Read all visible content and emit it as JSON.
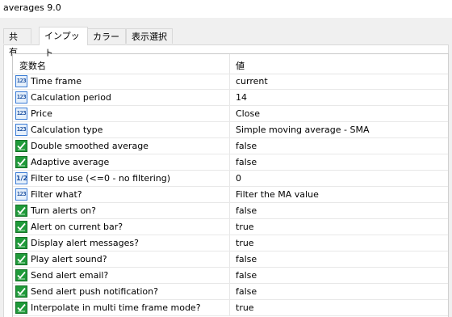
{
  "window": {
    "title": "averages 9.0"
  },
  "tabs": [
    {
      "label": "共有",
      "active": false
    },
    {
      "label": "インプット",
      "active": true
    },
    {
      "label": "カラー",
      "active": false
    },
    {
      "label": "表示選択",
      "active": false
    }
  ],
  "grid": {
    "headers": {
      "name": "変数名",
      "value": "値"
    },
    "rows": [
      {
        "icon": "int",
        "icon_text": "123",
        "name": "Time frame",
        "value": "current"
      },
      {
        "icon": "int",
        "icon_text": "123",
        "name": "Calculation period",
        "value": "14"
      },
      {
        "icon": "int",
        "icon_text": "123",
        "name": "Price",
        "value": "Close"
      },
      {
        "icon": "int",
        "icon_text": "123",
        "name": "Calculation type",
        "value": "Simple moving average - SMA"
      },
      {
        "icon": "bool",
        "icon_text": "",
        "name": "Double smoothed average",
        "value": "false"
      },
      {
        "icon": "bool",
        "icon_text": "",
        "name": "Adaptive average",
        "value": "false"
      },
      {
        "icon": "double",
        "icon_text": "1/2",
        "name": "Filter to use (<=0 - no filtering)",
        "value": "0"
      },
      {
        "icon": "int",
        "icon_text": "123",
        "name": "Filter what?",
        "value": "Filter the MA value"
      },
      {
        "icon": "bool",
        "icon_text": "",
        "name": "Turn alerts on?",
        "value": "false"
      },
      {
        "icon": "bool",
        "icon_text": "",
        "name": "Alert on current bar?",
        "value": "true"
      },
      {
        "icon": "bool",
        "icon_text": "",
        "name": "Display alert messages?",
        "value": "true"
      },
      {
        "icon": "bool",
        "icon_text": "",
        "name": "Play alert sound?",
        "value": "false"
      },
      {
        "icon": "bool",
        "icon_text": "",
        "name": "Send alert email?",
        "value": "false"
      },
      {
        "icon": "bool",
        "icon_text": "",
        "name": "Send alert push notification?",
        "value": "false"
      },
      {
        "icon": "bool",
        "icon_text": "",
        "name": "Interpolate in multi time frame mode?",
        "value": "true"
      }
    ]
  }
}
